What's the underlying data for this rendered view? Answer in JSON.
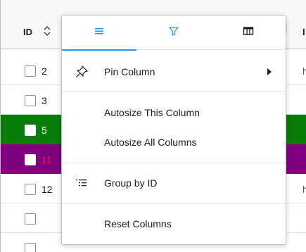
{
  "header": {
    "id_label": "ID",
    "sort_icon": "sort-icon",
    "next_label": "I"
  },
  "rows": [
    {
      "id": "2",
      "edge": "h",
      "highlight": "none"
    },
    {
      "id": "3",
      "edge": "",
      "highlight": "none"
    },
    {
      "id": "5",
      "edge": "",
      "highlight": "#0a7c0a"
    },
    {
      "id": "11",
      "edge": "",
      "highlight": "#800080"
    },
    {
      "id": "12",
      "edge": "h",
      "highlight": "none"
    },
    {
      "id": "",
      "edge": "",
      "highlight": "none"
    },
    {
      "id": "",
      "edge": "",
      "highlight": "none"
    }
  ],
  "column_menu": {
    "tabs": [
      {
        "icon": "menu-icon",
        "active": true
      },
      {
        "icon": "filter-icon",
        "active": false
      },
      {
        "icon": "columns-icon",
        "active": false
      }
    ],
    "items": {
      "pin_column": "Pin Column",
      "autosize_this": "Autosize This Column",
      "autosize_all": "Autosize All Columns",
      "group_by": "Group by ID",
      "reset_columns": "Reset Columns"
    }
  },
  "colors": {
    "accent": "#2196f3",
    "row_green": "#0a7c0a",
    "row_purple": "#800080",
    "id_red": "#e6194b"
  }
}
